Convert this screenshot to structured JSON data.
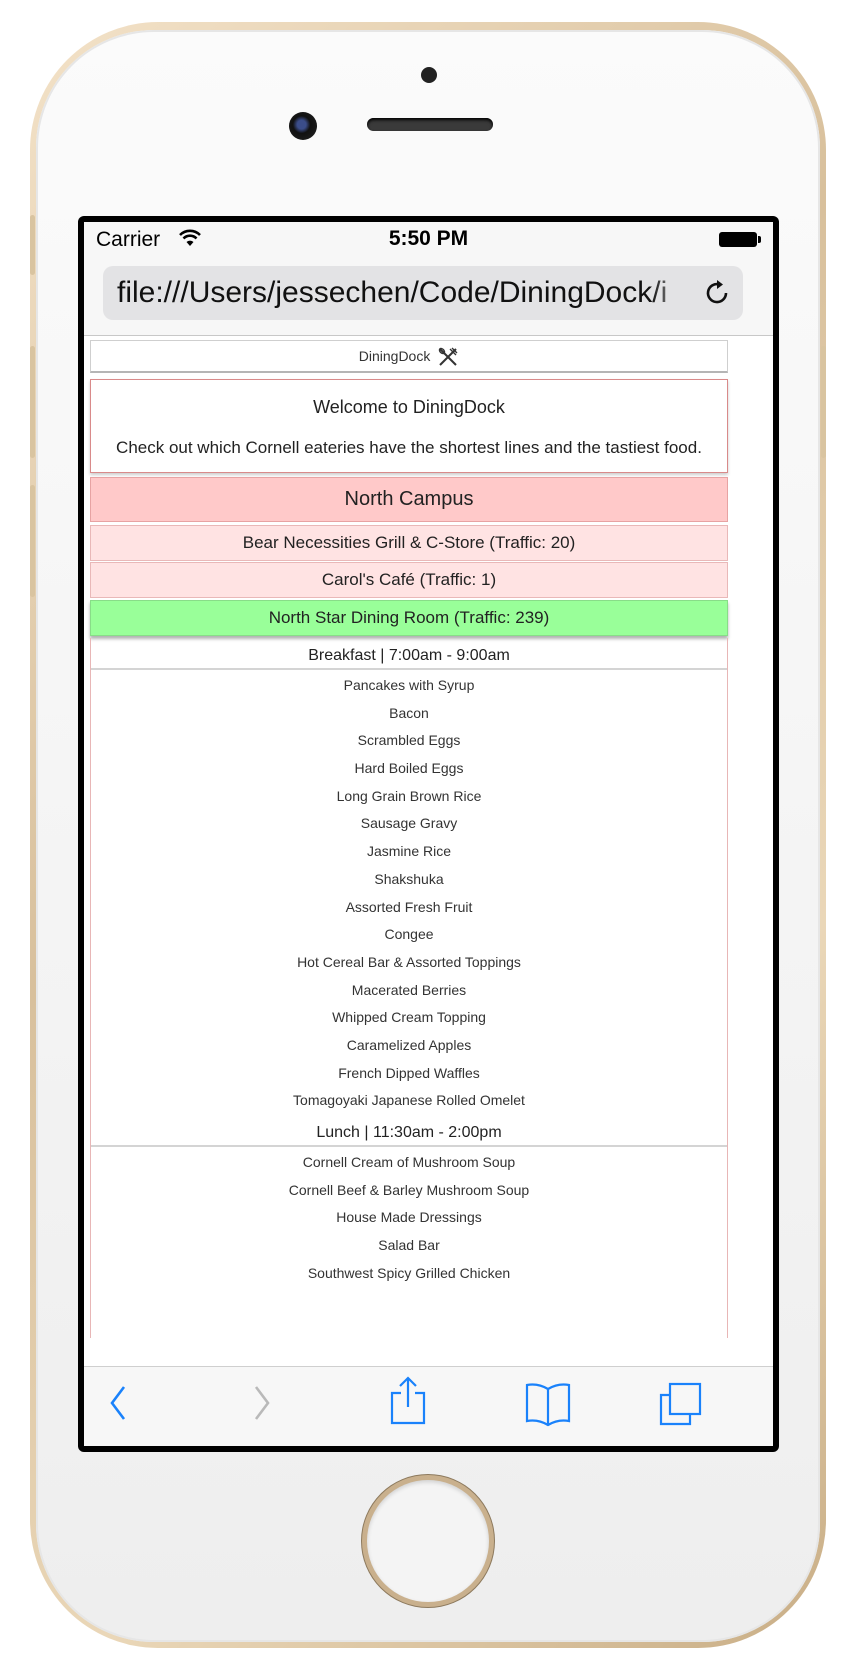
{
  "status_bar": {
    "carrier": "Carrier",
    "time": "5:50 PM"
  },
  "browser": {
    "url": "file:///Users/jessechen/Code/DiningDock/i"
  },
  "site": {
    "brand": "DiningDock",
    "welcome_title": "Welcome to DiningDock",
    "welcome_subtitle": "Check out which Cornell eateries have the shortest lines and the tastiest food."
  },
  "campus": {
    "name": "North Campus",
    "eateries": [
      {
        "label": "Bear Necessities Grill & C-Store (Traffic: 20)"
      },
      {
        "label": "Carol's Café (Traffic: 1)"
      },
      {
        "label": "North Star Dining Room (Traffic: 239)"
      }
    ]
  },
  "menu": {
    "meals": [
      {
        "header": "Breakfast | 7:00am - 9:00am",
        "items": [
          "Pancakes with Syrup",
          "Bacon",
          "Scrambled Eggs",
          "Hard Boiled Eggs",
          "Long Grain Brown Rice",
          "Sausage Gravy",
          "Jasmine Rice",
          "Shakshuka",
          "Assorted Fresh Fruit",
          "Congee",
          "Hot Cereal Bar & Assorted Toppings",
          "Macerated Berries",
          "Whipped Cream Topping",
          "Caramelized Apples",
          "French Dipped Waffles",
          "Tomagoyaki Japanese Rolled Omelet"
        ]
      },
      {
        "header": "Lunch | 11:30am - 2:00pm",
        "items": [
          "Cornell Cream of Mushroom Soup",
          "Cornell Beef & Barley Mushroom Soup",
          "House Made Dressings",
          "Salad Bar",
          "Southwest Spicy Grilled Chicken"
        ]
      }
    ]
  },
  "colors": {
    "campus_bg": "#ffc9c9",
    "eatery_bg": "#ffe3e3",
    "active_eatery_bg": "#99ff99",
    "ios_blue": "#1a82fb"
  },
  "icons": {
    "wifi": "wifi-icon",
    "battery": "battery-icon",
    "reload": "reload-icon",
    "utensils": "utensils-icon",
    "back": "back-chevron-icon",
    "forward": "forward-chevron-icon",
    "share": "share-icon",
    "bookmarks": "bookmarks-icon",
    "tabs": "tabs-icon"
  }
}
